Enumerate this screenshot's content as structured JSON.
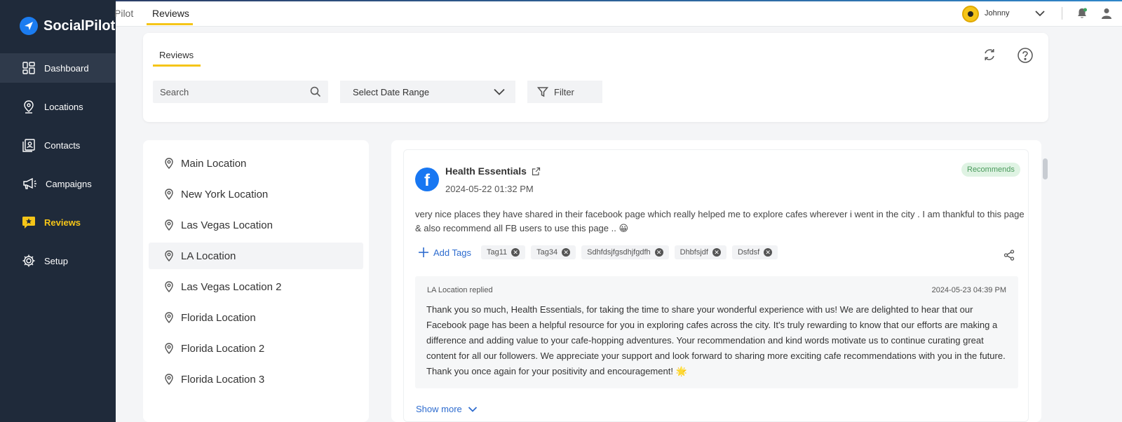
{
  "app": {
    "name": "SocialPilot",
    "brand_color": "#1b7cf0",
    "accent_color": "#f5c518",
    "sidebar_color": "#1f2a3a"
  },
  "sidebar": {
    "items": [
      {
        "label": "Dashboard",
        "icon": "dashboard-icon"
      },
      {
        "label": "Locations",
        "icon": "location-pin-icon"
      },
      {
        "label": "Contacts",
        "icon": "contacts-icon"
      },
      {
        "label": "Campaigns",
        "icon": "megaphone-icon"
      },
      {
        "label": "Reviews",
        "icon": "star-icon"
      },
      {
        "label": "Setup",
        "icon": "gear-icon"
      }
    ]
  },
  "topbar": {
    "tabs": [
      "Pilot",
      "Reviews"
    ],
    "user": {
      "name": "Johnny"
    }
  },
  "header": {
    "tab": "Reviews",
    "search_placeholder": "Search",
    "date_range_label": "Select Date Range",
    "filter_label": "Filter"
  },
  "locations": [
    "Main Location",
    "New York Location",
    "Las Vegas Location",
    "LA Location",
    "Las Vegas Location 2",
    "Florida Location",
    "Florida Location 2",
    "Florida Location 3"
  ],
  "review": {
    "source_icon": "facebook-icon",
    "reviewer": "Health Essentials",
    "date": "2024-05-22 01:32 PM",
    "badge": "Recommends",
    "text": "very nice places they have shared in their facebook page which really helped me to explore cafes wherever i went in the city . I am thankful to this page & also recommend all FB users to use this page .. 😀",
    "add_tags_label": "Add Tags",
    "tags": [
      "Tag11",
      "Tag34",
      "Sdhfdsjfgsdhjfgdfh",
      "Dhbfsjdf",
      "Dsfdsf"
    ],
    "reply": {
      "label": "LA Location replied",
      "date": "2024-05-23 04:39 PM",
      "text": "Thank you so much, Health Essentials, for taking the time to share your wonderful experience with us! We are delighted to hear that our Facebook page has been a helpful resource for you in exploring cafes across the city. It's truly rewarding to know that our efforts are making a difference and adding value to your cafe-hopping adventures. Your recommendation and kind words motivate us to continue curating great content for all our followers. We appreciate your support and look forward to sharing more exciting cafe recommendations with you in the future. Thank you once again for your positivity and encouragement! 🌟"
    },
    "show_more_label": "Show more"
  }
}
